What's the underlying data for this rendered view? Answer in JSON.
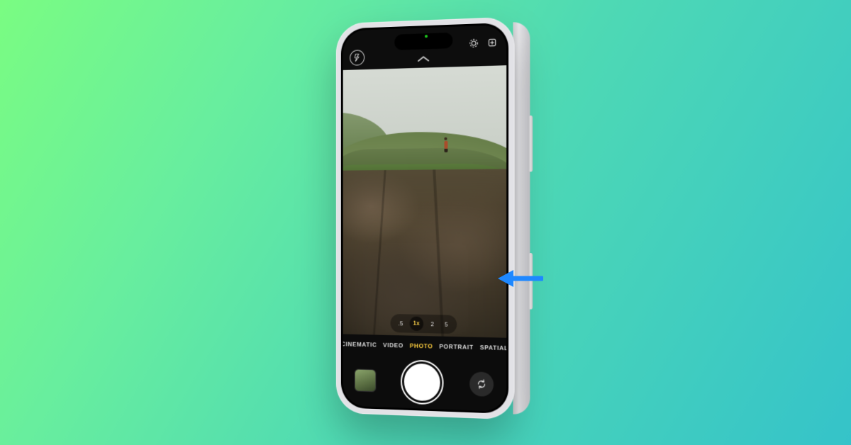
{
  "camera": {
    "zoom_levels": [
      ".5",
      "1x",
      "2",
      "5"
    ],
    "zoom_selected_index": 1,
    "modes": [
      "CINEMATIC",
      "VIDEO",
      "PHOTO",
      "PORTRAIT",
      "SPATIAL"
    ],
    "mode_selected_index": 2
  },
  "icons": {
    "flash": "flash-off-icon",
    "night": "night-mode-icon",
    "styles": "photographic-styles-icon",
    "chevron": "chevron-up-icon",
    "flip": "camera-flip-icon",
    "arrow": "pointer-arrow-icon"
  },
  "colors": {
    "accent": "#ffcf3e",
    "arrow": "#1e88ff"
  }
}
